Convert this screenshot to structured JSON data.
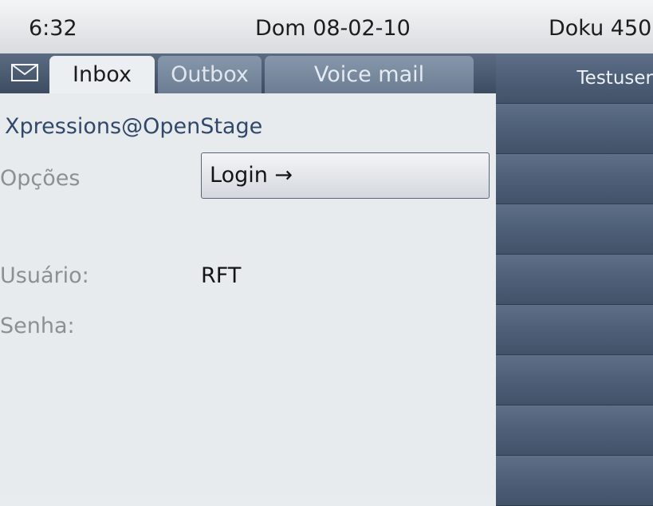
{
  "status_bar": {
    "time": "6:32",
    "date": "Dom 08-02-10",
    "device": "Doku 450"
  },
  "tabs": [
    {
      "label": "Inbox",
      "active": true
    },
    {
      "label": "Outbox",
      "active": false
    },
    {
      "label": "Voice mail",
      "active": false
    }
  ],
  "app_title": "Xpressions@OpenStage",
  "form": {
    "options_label": "Opções",
    "options_value": "Login →",
    "user_label": "Usuário:",
    "user_value": "RFT",
    "password_label": "Senha:"
  },
  "side_panel": {
    "keys": [
      "Testuser",
      "",
      "",
      "",
      "",
      "",
      "",
      "",
      ""
    ]
  },
  "icons": {
    "message": "envelope-icon"
  }
}
